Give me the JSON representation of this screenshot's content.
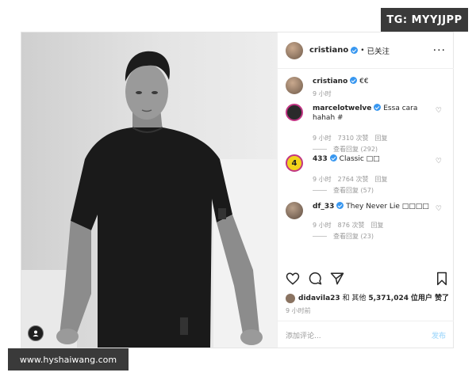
{
  "watermark_tg": "TG: MYYJJPP",
  "watermark_site": "www.hyshaiwang.com",
  "post": {
    "username": "cristiano",
    "separator": "•",
    "follow_status": "已关注",
    "more": "···"
  },
  "caption": {
    "username": "cristiano",
    "text": "€€",
    "time": "9 小时"
  },
  "comments": [
    {
      "username": "marcelotwelve",
      "text": "Essa cara hahah #",
      "time": "9 小时",
      "likes": "7310 次赞",
      "reply": "回复",
      "view_replies": "查看回复 (292)"
    },
    {
      "username": "433",
      "text": "Classic □□",
      "time": "9 小时",
      "likes": "2764 次赞",
      "reply": "回复",
      "view_replies": "查看回复 (57)"
    },
    {
      "username": "df_33",
      "text": "They Never Lie □□□□",
      "time": "9 小时",
      "likes": "876 次赞",
      "reply": "回复",
      "view_replies": "查看回复 (23)"
    }
  ],
  "likes_line": {
    "user": "didavila23",
    "mid": "和 其他",
    "count": "5,371,024",
    "suffix": "位用户 赞了"
  },
  "post_time": "9 小时前",
  "add_comment_placeholder": "添加评论...",
  "post_button": "发布",
  "badge_433": "4"
}
